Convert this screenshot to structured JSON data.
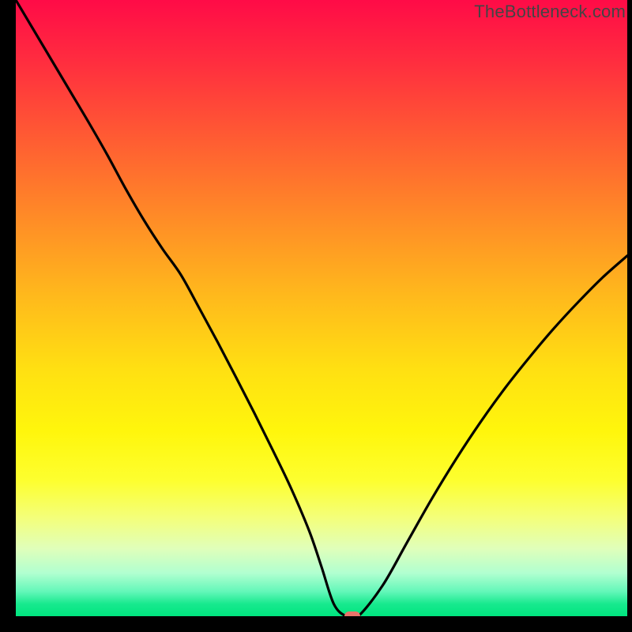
{
  "watermark": "TheBottleneck.com",
  "chart_data": {
    "type": "line",
    "title": "",
    "xlabel": "",
    "ylabel": "",
    "xlim": [
      0,
      100
    ],
    "ylim": [
      0,
      100
    ],
    "x": [
      0,
      3,
      6,
      9,
      12,
      15,
      18,
      21,
      24,
      27,
      30,
      33,
      36,
      39,
      42,
      45,
      48,
      50,
      52,
      54,
      56,
      60,
      64,
      68,
      72,
      76,
      80,
      84,
      88,
      92,
      96,
      100
    ],
    "values": [
      100,
      95.0,
      90.0,
      85.0,
      80.0,
      74.8,
      69.3,
      64.2,
      59.6,
      55.4,
      50.0,
      44.5,
      38.8,
      33.0,
      27.0,
      20.8,
      13.8,
      8.0,
      2.0,
      0.0,
      0.0,
      5.0,
      12.0,
      19.0,
      25.5,
      31.5,
      37.0,
      42.0,
      46.7,
      51.0,
      55.0,
      58.5
    ],
    "marker": {
      "x": 55,
      "y": 0
    }
  },
  "colors": {
    "frame": "#000000",
    "curve": "#000000",
    "marker": "#e8746a"
  }
}
